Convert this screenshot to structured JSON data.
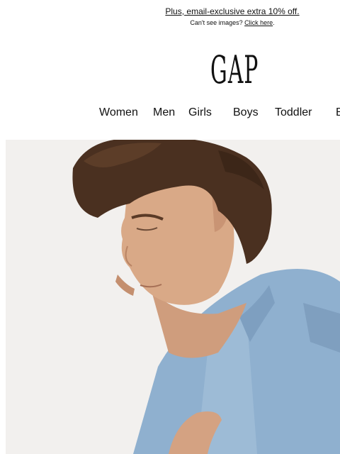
{
  "promo": {
    "headline": "Plus, email-exclusive extra 10% off.",
    "subline_prefix": "Can't see images? ",
    "subline_link": "Click here",
    "subline_suffix": "."
  },
  "brand": {
    "logo_text": "GAP"
  },
  "nav": {
    "items": [
      {
        "label": "Women"
      },
      {
        "label": "Men"
      },
      {
        "label": "Girls"
      },
      {
        "label": "Boys"
      },
      {
        "label": "Toddler"
      },
      {
        "label": "B"
      }
    ]
  },
  "hero": {
    "image": "man-in-denim-shirt-photo",
    "colors": {
      "background": "#f2f0ee",
      "denim": "#8fb0cf",
      "hair": "#4a3020",
      "skin": "#d9a987"
    }
  }
}
